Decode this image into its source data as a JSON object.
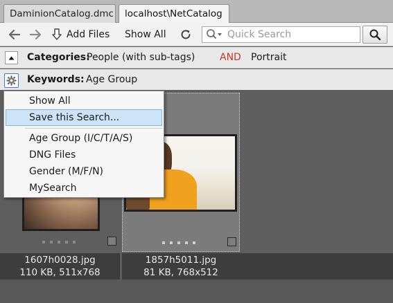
{
  "tabs": [
    {
      "label": "DaminionCatalog.dmc",
      "active": false
    },
    {
      "label": "localhost\\NetCatalog",
      "active": true
    }
  ],
  "toolbar": {
    "back_icon": "arrow-left-icon",
    "forward_icon": "arrow-right-icon",
    "add_files_label": "Add Files",
    "show_all_label": "Show All",
    "refresh_icon": "refresh-icon",
    "search_placeholder": "Quick Search",
    "search_icon": "magnifier-icon"
  },
  "filters": {
    "categories": {
      "label": "Categories:",
      "value": "People (with sub-tags)",
      "operator": "AND",
      "value2": "Portrait",
      "operator_color": "#c0392b"
    },
    "keywords": {
      "label": "Keywords:",
      "value": "Age Group"
    }
  },
  "menu": {
    "items": [
      {
        "label": "Show All"
      },
      {
        "label": "Save this Search...",
        "highlighted": true
      },
      {
        "label": "Age Group  (I/C/T/A/S)"
      },
      {
        "label": "DNG Files"
      },
      {
        "label": "Gender (M/F/N)"
      },
      {
        "label": "MySearch"
      }
    ]
  },
  "files": [
    {
      "name": "1607h0028.jpg",
      "meta": "110 KB, 511x768"
    },
    {
      "name": "1857h5011.jpg",
      "meta": "81 KB, 768x512"
    }
  ],
  "colors": {
    "selection": "#cde4f7",
    "accent": "#3a7bd5"
  }
}
